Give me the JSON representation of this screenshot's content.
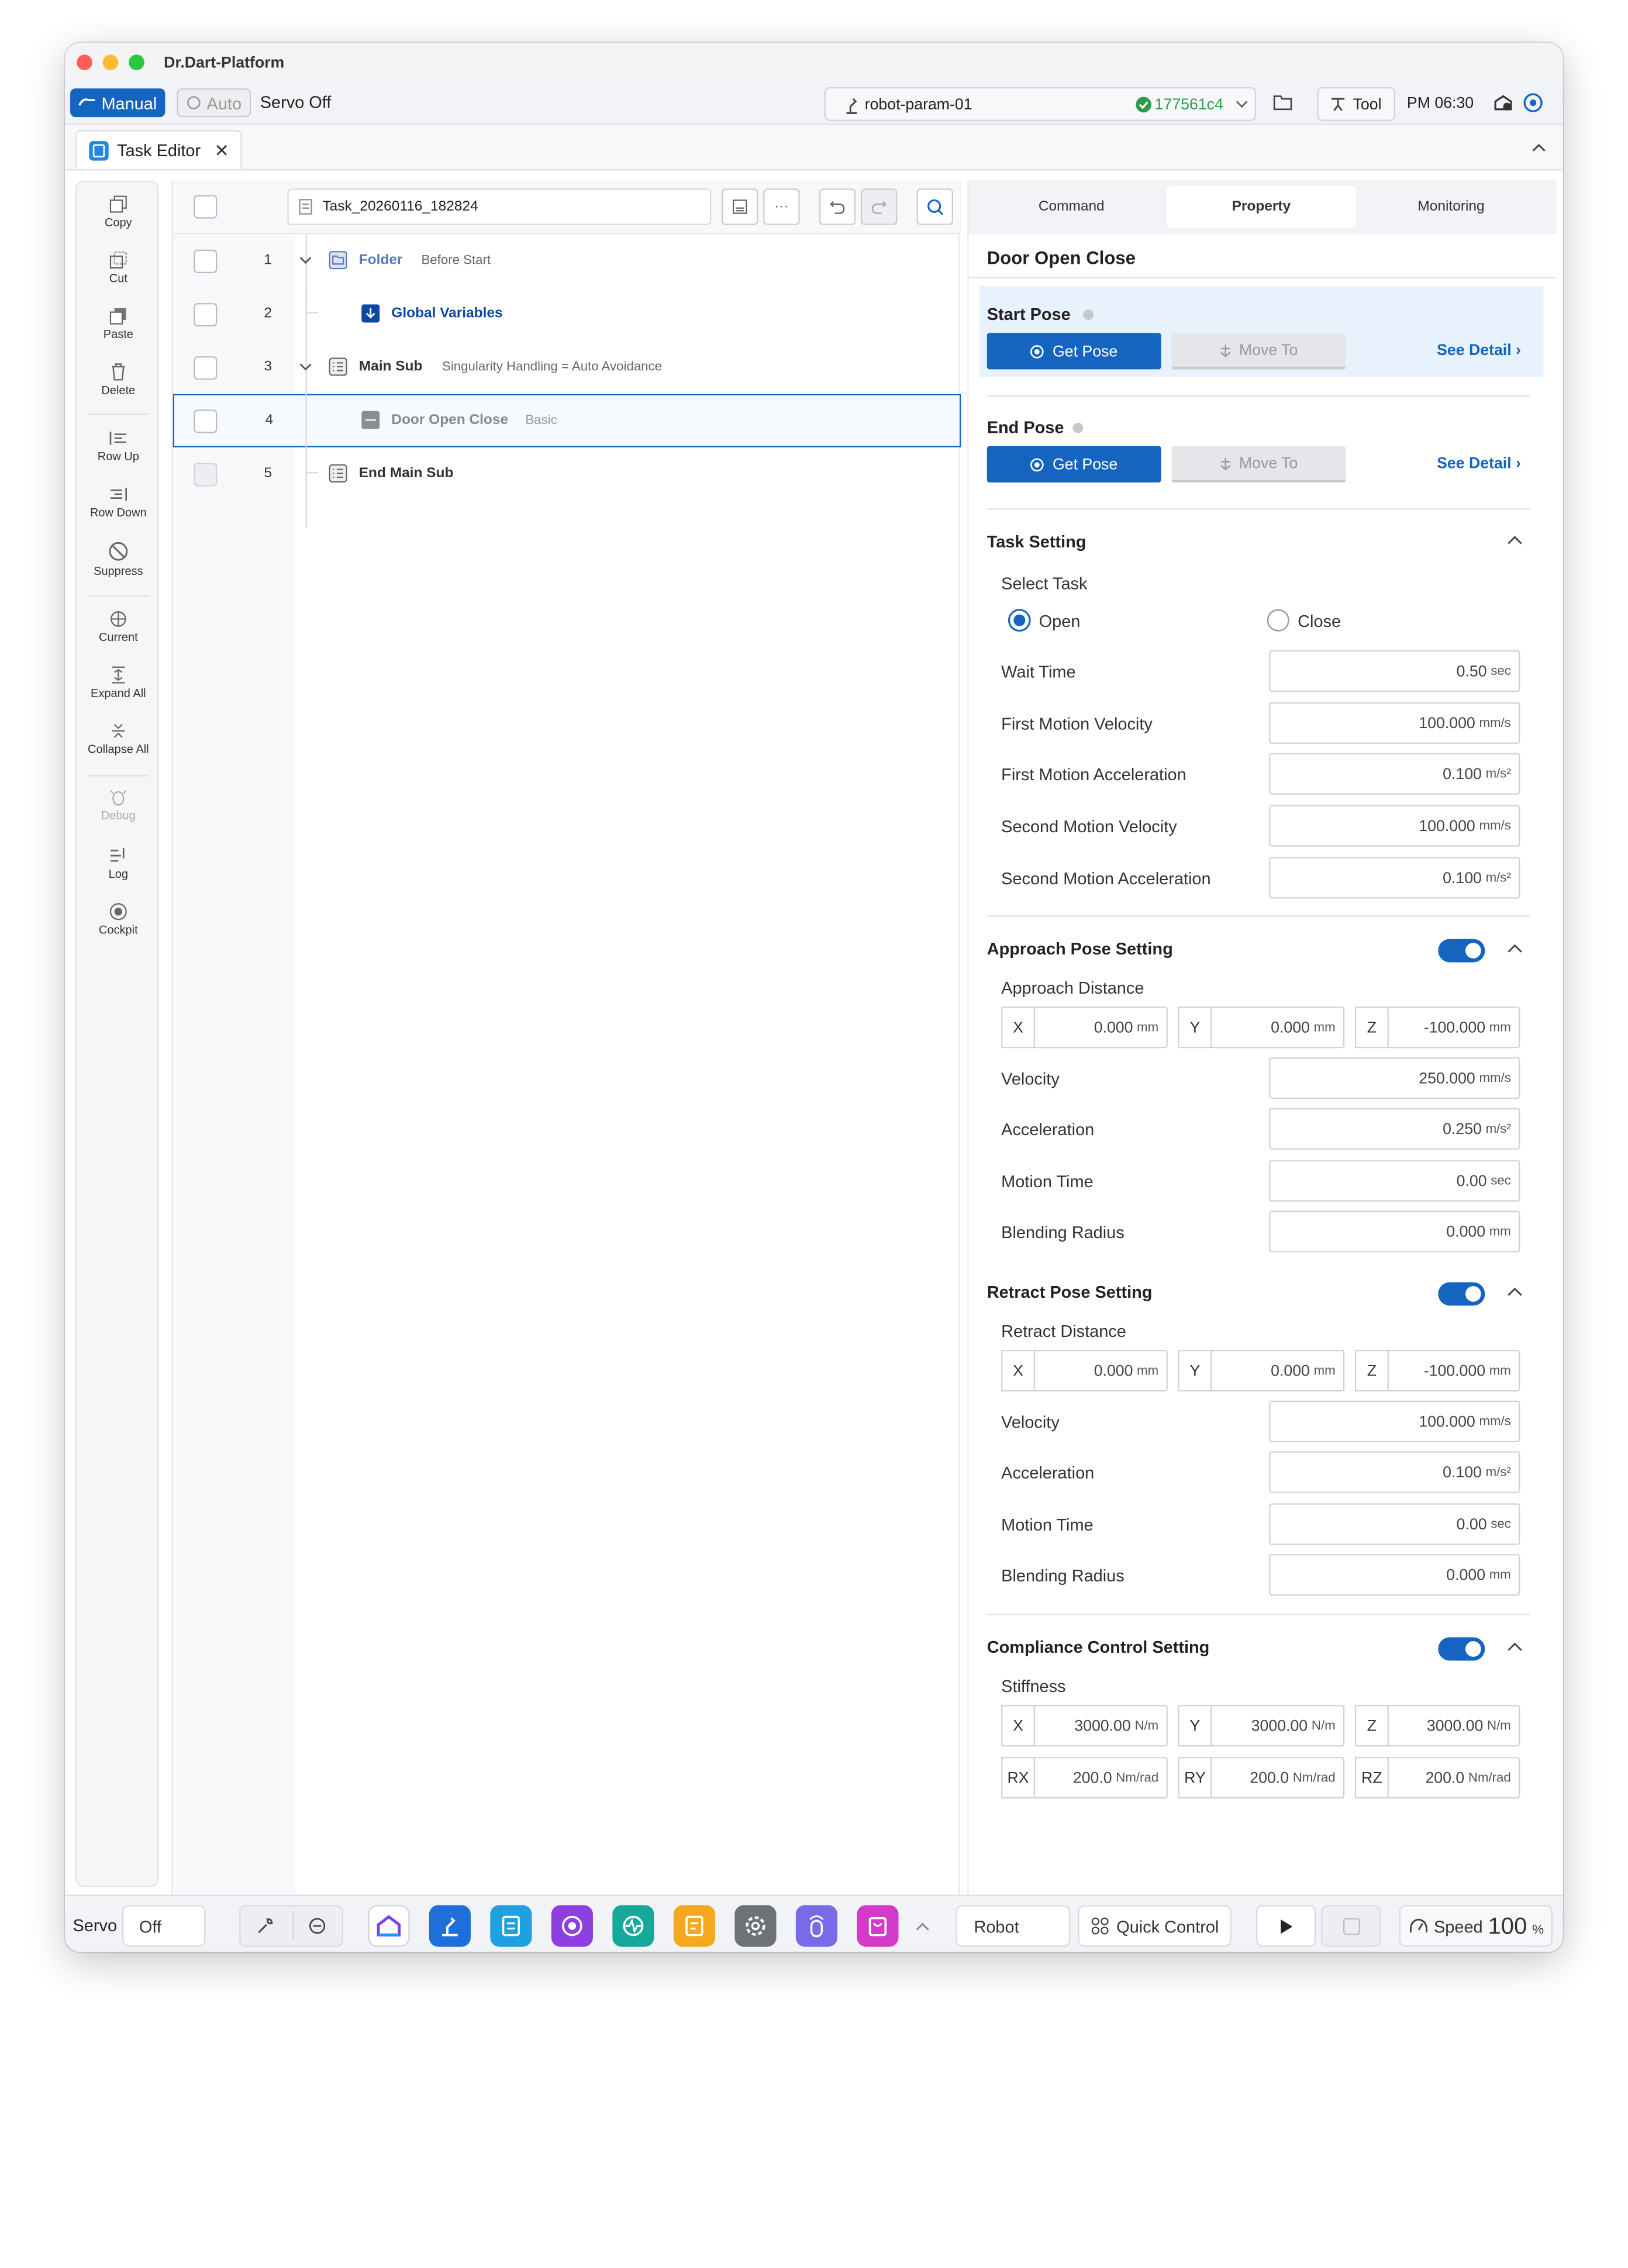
{
  "app": {
    "title": "Dr.Dart-Platform",
    "tab": "Task Editor"
  },
  "toolbar": {
    "manual": "Manual",
    "auto": "Auto",
    "servo_status": "Servo Off",
    "robot_param": "robot-param-01",
    "commit": "177561c4",
    "tool": "Tool",
    "time": "PM 06:30"
  },
  "sidebar": {
    "items": [
      "Copy",
      "Cut",
      "Paste",
      "Delete",
      "Row Up",
      "Row Down",
      "Suppress",
      "Current",
      "Expand All",
      "Collapse All",
      "Debug",
      "Log",
      "Cockpit"
    ]
  },
  "tree": {
    "filename": "Task_20260116_182824",
    "rows": [
      {
        "num": "1",
        "title": "Folder",
        "sub": "Before Start"
      },
      {
        "num": "2",
        "title": "Global Variables",
        "sub": ""
      },
      {
        "num": "3",
        "title": "Main Sub",
        "sub": "Singularity Handling = Auto Avoidance"
      },
      {
        "num": "4",
        "title": "Door Open Close",
        "sub": "Basic"
      },
      {
        "num": "5",
        "title": "End Main Sub",
        "sub": ""
      }
    ]
  },
  "panel": {
    "tabs": [
      "Command",
      "Property",
      "Monitoring"
    ],
    "title": "Door Open Close",
    "start_pose": "Start Pose",
    "end_pose": "End Pose",
    "get_pose": "Get Pose",
    "move_to": "Move To",
    "see_detail": "See Detail",
    "task_setting": {
      "title": "Task Setting",
      "select_task": "Select Task",
      "open": "Open",
      "close": "Close",
      "rows": [
        {
          "label": "Wait Time",
          "value": "0.50",
          "unit": "sec"
        },
        {
          "label": "First Motion Velocity",
          "value": "100.000",
          "unit": "mm/s"
        },
        {
          "label": "First Motion Acceleration",
          "value": "0.100",
          "unit": "m/s²"
        },
        {
          "label": "Second Motion Velocity",
          "value": "100.000",
          "unit": "mm/s"
        },
        {
          "label": "Second Motion Acceleration",
          "value": "0.100",
          "unit": "m/s²"
        }
      ]
    },
    "approach": {
      "title": "Approach Pose Setting",
      "distance_label": "Approach Distance",
      "xyz": [
        {
          "axis": "X",
          "value": "0.000",
          "unit": "mm"
        },
        {
          "axis": "Y",
          "value": "0.000",
          "unit": "mm"
        },
        {
          "axis": "Z",
          "value": "-100.000",
          "unit": "mm"
        }
      ],
      "rows": [
        {
          "label": "Velocity",
          "value": "250.000",
          "unit": "mm/s"
        },
        {
          "label": "Acceleration",
          "value": "0.250",
          "unit": "m/s²"
        },
        {
          "label": "Motion Time",
          "value": "0.00",
          "unit": "sec"
        },
        {
          "label": "Blending Radius",
          "value": "0.000",
          "unit": "mm"
        }
      ]
    },
    "retract": {
      "title": "Retract Pose Setting",
      "distance_label": "Retract Distance",
      "xyz": [
        {
          "axis": "X",
          "value": "0.000",
          "unit": "mm"
        },
        {
          "axis": "Y",
          "value": "0.000",
          "unit": "mm"
        },
        {
          "axis": "Z",
          "value": "-100.000",
          "unit": "mm"
        }
      ],
      "rows": [
        {
          "label": "Velocity",
          "value": "100.000",
          "unit": "mm/s"
        },
        {
          "label": "Acceleration",
          "value": "0.100",
          "unit": "m/s²"
        },
        {
          "label": "Motion Time",
          "value": "0.00",
          "unit": "sec"
        },
        {
          "label": "Blending Radius",
          "value": "0.000",
          "unit": "mm"
        }
      ]
    },
    "compliance": {
      "title": "Compliance Control Setting",
      "stiffness_label": "Stiffness",
      "xyz": [
        {
          "axis": "X",
          "value": "3000.00",
          "unit": "N/m"
        },
        {
          "axis": "Y",
          "value": "3000.00",
          "unit": "N/m"
        },
        {
          "axis": "Z",
          "value": "3000.00",
          "unit": "N/m"
        }
      ],
      "rxyz": [
        {
          "axis": "RX",
          "value": "200.0",
          "unit": "Nm/rad"
        },
        {
          "axis": "RY",
          "value": "200.0",
          "unit": "Nm/rad"
        },
        {
          "axis": "RZ",
          "value": "200.0",
          "unit": "Nm/rad"
        }
      ]
    }
  },
  "bottom": {
    "servo": "Servo",
    "off": "Off",
    "robot": "Robot",
    "quick_control": "Quick Control",
    "speed": "Speed",
    "speed_value": "100",
    "speed_unit": "%"
  },
  "colors": {
    "accent": "#1565c0",
    "success": "#2e9d4b"
  }
}
